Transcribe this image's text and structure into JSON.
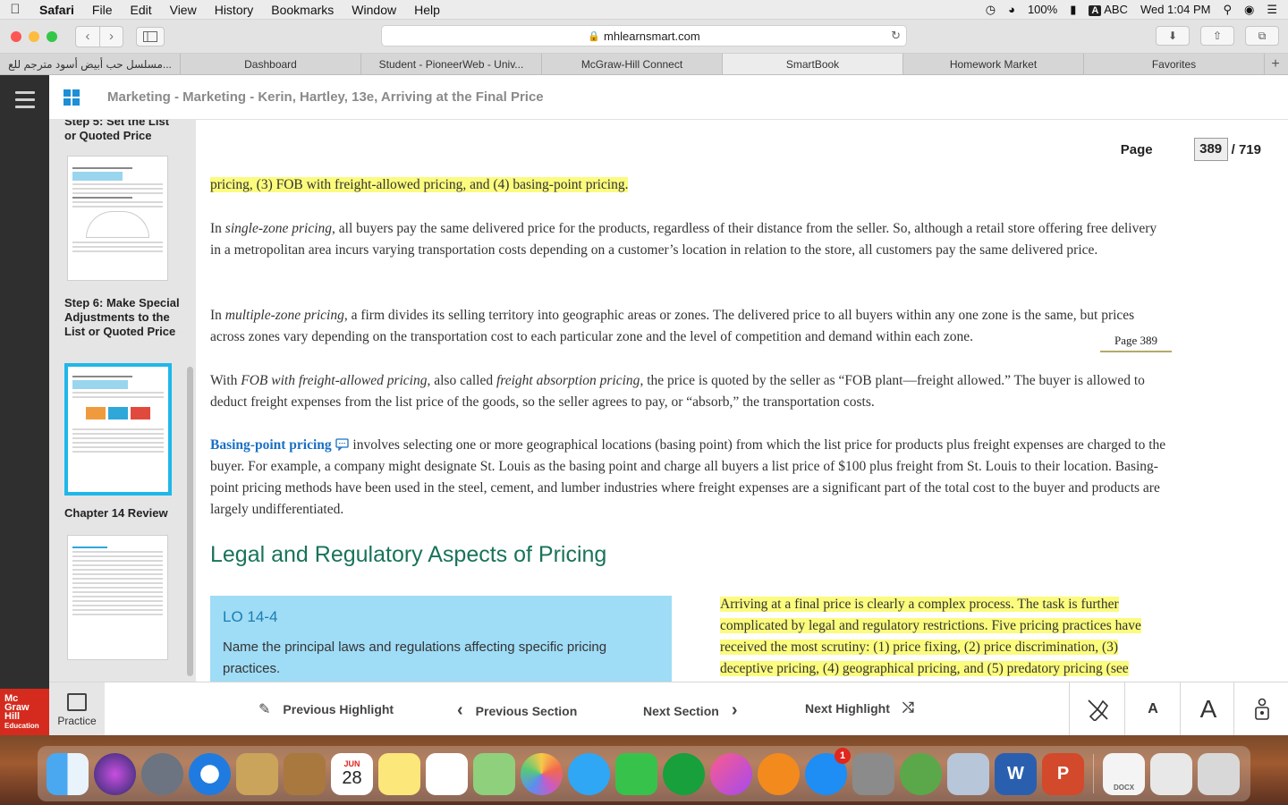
{
  "menubar": {
    "app": "Safari",
    "items": [
      "File",
      "Edit",
      "View",
      "History",
      "Bookmarks",
      "Window",
      "Help"
    ],
    "battery": "100%",
    "input_source": "ABC",
    "input_badge": "A",
    "clock": "Wed 1:04 PM"
  },
  "toolbar": {
    "url": "mhlearnsmart.com"
  },
  "tabs": [
    {
      "label": "مسلسل حب أبيض أسود مترجم للع..."
    },
    {
      "label": "Dashboard"
    },
    {
      "label": "Student - PioneerWeb - Univ..."
    },
    {
      "label": "McGraw-Hill Connect"
    },
    {
      "label": "SmartBook"
    },
    {
      "label": "Homework Market"
    },
    {
      "label": "Favorites"
    }
  ],
  "app": {
    "title": "Marketing - Marketing - Kerin, Hartley, 13e, Arriving at the Final Price"
  },
  "sidebar": {
    "sections": [
      {
        "label": "Step 5: Set the List or Quoted Price"
      },
      {
        "label": "Step 6: Make Special Adjustments to the List or Quoted Price"
      },
      {
        "label": "Chapter 14 Review"
      }
    ]
  },
  "page": {
    "label": "Page",
    "current": "389",
    "total": "/ 719",
    "marker": "Page 389"
  },
  "content": {
    "p0_highlight": "pricing, (3) FOB with freight-allowed pricing, and (4) basing-point pricing.",
    "p1_a": "In ",
    "p1_term": "single-zone pricing",
    "p1_b": ", all buyers pay the same delivered price for the products, regardless of their distance from the seller. So, although a retail store offering free delivery in a metropolitan area incurs varying transportation costs depending on a customer’s location in relation to the store, all customers pay the same delivered price.",
    "p2_a": "In ",
    "p2_term": "multiple-zone pricing",
    "p2_b": ", a firm divides its selling territory into geographic areas or zones. The delivered price to all buyers within any one zone is the same, but prices across zones vary depending on the transportation cost to each particular zone and the level of competition and demand within each zone.",
    "p3_a": "With ",
    "p3_term1": "FOB with freight-allowed pricing",
    "p3_b": ", also called ",
    "p3_term2": "freight absorption pricing",
    "p3_c": ", the price is quoted by the seller as “FOB plant—freight allowed.” The buyer is allowed to deduct freight expenses from the list price of the goods, so the seller agrees to pay, or “absorb,” the transportation costs.",
    "p4_term": "Basing-point pricing",
    "p4_b": " involves selecting one or more geographical locations (basing point) from which the list price for products plus freight expenses are charged to the buyer. For example, a company might designate St. Louis as the basing point and charge all buyers a list price of $100 plus freight from St. Louis to their location. Basing-point pricing methods have been used in the steel, cement, and lumber industries where freight expenses are a significant part of the total cost to the buyer and products are largely undifferentiated.",
    "heading": "Legal and Regulatory Aspects of Pricing",
    "lo_title": "LO 14-4",
    "lo_text": "Name the principal laws and regulations affecting specific pricing practices.",
    "right_highlight": "Arriving at a final price is clearly a complex process. The task is further complicated by legal and regulatory restrictions. Five pricing practices have received the most scrutiny: (1) price fixing, (2) price discrimination, (3) deceptive pricing, (4) geographical pricing, and (5) predatory pricing (see"
  },
  "bottombar": {
    "practice": "Practice",
    "prev_highlight": "Previous Highlight",
    "prev_section": "Previous Section",
    "next_section": "Next Section",
    "next_highlight": "Next Highlight",
    "font_small": "A",
    "font_large": "A"
  },
  "logo": {
    "line1": "Mc",
    "line2": "Graw",
    "line3": "Hill",
    "line4": "Education"
  },
  "dock": {
    "calendar_month": "JUN",
    "calendar_day": "28",
    "appstore_badge": "1",
    "word": "W",
    "powerpoint": "P",
    "docx": "DOCX"
  },
  "colors": {
    "highlight": "#fbfb7e",
    "term_blue": "#1a6fc4",
    "heading_green": "#19735a",
    "lo_box": "#9fdcf6",
    "active_thumb": "#1fb7ea",
    "mh_red": "#d52b1e"
  }
}
